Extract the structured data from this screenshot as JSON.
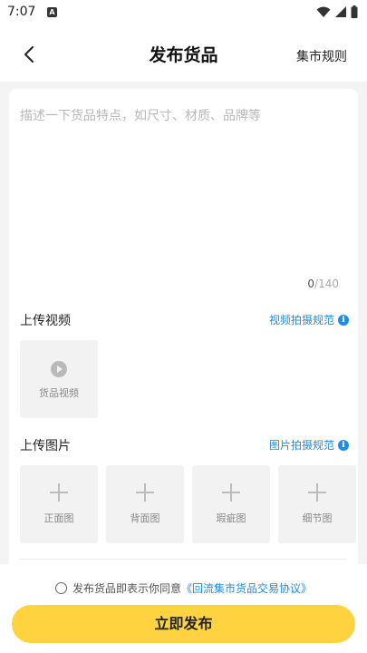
{
  "status_bar": {
    "time": "7:07",
    "notification_letter": "A"
  },
  "nav": {
    "title": "发布货品",
    "rules_label": "集市规则"
  },
  "description": {
    "placeholder": "描述一下货品特点，如尺寸、材质、品牌等",
    "count": "0",
    "max": "/140"
  },
  "video": {
    "title": "上传视频",
    "guide_link": "视频拍摄规范",
    "tile_label": "货品视频"
  },
  "images": {
    "title": "上传图片",
    "guide_link": "图片拍摄规范",
    "tiles": [
      "正面图",
      "背面图",
      "瑕疵图",
      "细节图"
    ]
  },
  "agreement": {
    "text": "发布货品即表示你同意",
    "link": "《回流集市货品交易协议》"
  },
  "publish_button": "立即发布",
  "colors": {
    "accent": "#fed33f",
    "link": "#1f8ce6"
  }
}
